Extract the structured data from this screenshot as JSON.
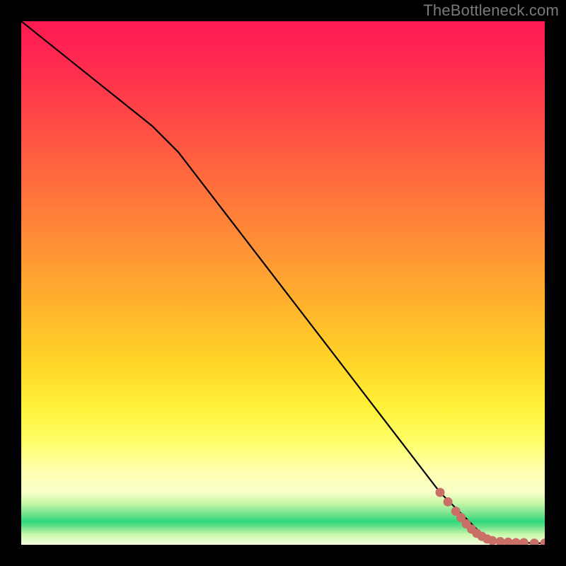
{
  "watermark": "TheBottleneck.com",
  "colors": {
    "line": "#000000",
    "marker_fill": "#c96f66",
    "marker_stroke": "#c96f66"
  },
  "chart_data": {
    "type": "line",
    "title": "",
    "xlabel": "",
    "ylabel": "",
    "xlim": [
      0,
      100
    ],
    "ylim": [
      0,
      100
    ],
    "grid": false,
    "series": [
      {
        "name": "main-curve",
        "x": [
          0,
          10,
          20,
          25,
          30,
          40,
          50,
          60,
          70,
          80,
          85,
          88,
          90,
          92,
          94,
          96,
          98,
          100
        ],
        "y": [
          100,
          92,
          84,
          80,
          75,
          62,
          49,
          36,
          23,
          10,
          5,
          2,
          1,
          0.7,
          0.5,
          0.4,
          0.3,
          0.3
        ]
      }
    ],
    "markers": [
      {
        "name": "pt-a",
        "x": 80.0,
        "y": 10.0
      },
      {
        "name": "pt-b",
        "x": 81.5,
        "y": 8.2
      },
      {
        "name": "pt-c",
        "x": 83.0,
        "y": 6.4
      },
      {
        "name": "pt-d",
        "x": 84.0,
        "y": 5.2
      },
      {
        "name": "pt-e",
        "x": 85.0,
        "y": 4.0
      },
      {
        "name": "pt-f",
        "x": 86.0,
        "y": 3.0
      },
      {
        "name": "pt-g",
        "x": 87.0,
        "y": 2.2
      },
      {
        "name": "pt-h",
        "x": 88.0,
        "y": 1.6
      },
      {
        "name": "pt-i",
        "x": 89.0,
        "y": 1.1
      },
      {
        "name": "pt-j",
        "x": 90.0,
        "y": 0.8
      },
      {
        "name": "pt-k",
        "x": 91.5,
        "y": 0.6
      },
      {
        "name": "pt-l",
        "x": 93.0,
        "y": 0.5
      },
      {
        "name": "pt-m",
        "x": 94.5,
        "y": 0.4
      },
      {
        "name": "pt-n",
        "x": 96.0,
        "y": 0.4
      },
      {
        "name": "pt-o",
        "x": 98.0,
        "y": 0.3
      },
      {
        "name": "pt-p",
        "x": 100.0,
        "y": 0.3
      }
    ]
  }
}
